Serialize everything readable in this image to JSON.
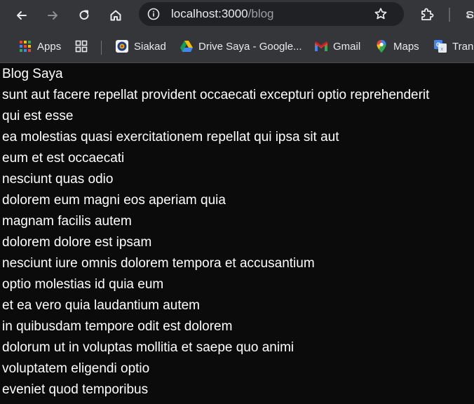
{
  "browser": {
    "url_host": "localhost:3000",
    "url_path": "/blog",
    "partial_icon": "ຣ"
  },
  "bookmarks": [
    {
      "label": "Apps",
      "icon": "apps-grid-icon"
    },
    {
      "label": "",
      "icon": "tab-groups-icon"
    },
    {
      "label": "Siakad",
      "icon": "siakad-logo-icon"
    },
    {
      "label": "Drive Saya - Google...",
      "icon": "google-drive-icon"
    },
    {
      "label": "Gmail",
      "icon": "gmail-icon"
    },
    {
      "label": "Maps",
      "icon": "maps-pin-icon"
    },
    {
      "label": "Tran",
      "icon": "google-translate-icon"
    }
  ],
  "page": {
    "heading": "Blog Saya",
    "posts": [
      "sunt aut facere repellat provident occaecati excepturi optio reprehenderit",
      "qui est esse",
      "ea molestias quasi exercitationem repellat qui ipsa sit aut",
      "eum et est occaecati",
      "nesciunt quas odio",
      "dolorem eum magni eos aperiam quia",
      "magnam facilis autem",
      "dolorem dolore est ipsam",
      "nesciunt iure omnis dolorem tempora et accusantium",
      "optio molestias id quia eum",
      "et ea vero quia laudantium autem",
      "in quibusdam tempore odit est dolorem",
      "dolorum ut in voluptas mollitia et saepe quo animi",
      "voluptatem eligendi optio",
      "eveniet quod temporibus"
    ]
  },
  "colors": {
    "toolbar": "#35363a",
    "omnibox": "#202124",
    "page_bg": "#0b0b0b",
    "text": "#ffffff"
  }
}
